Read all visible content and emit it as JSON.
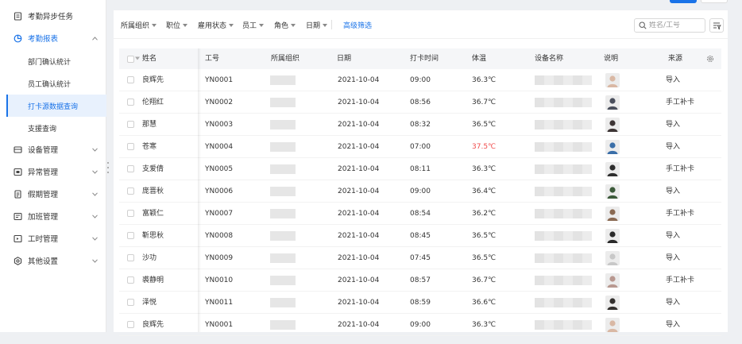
{
  "sidebar": {
    "items": [
      {
        "label": "考勤异步任务",
        "icon": "task-list-icon"
      },
      {
        "label": "考勤报表",
        "icon": "chart-pie-icon",
        "expanded": true,
        "children": [
          {
            "label": "部门确认统计"
          },
          {
            "label": "员工确认统计"
          },
          {
            "label": "打卡源数据查询",
            "selected": true
          },
          {
            "label": "支援查询"
          }
        ]
      },
      {
        "label": "设备管理",
        "icon": "device-icon"
      },
      {
        "label": "异常管理",
        "icon": "alert-box-icon"
      },
      {
        "label": "假期管理",
        "icon": "calendar-doc-icon"
      },
      {
        "label": "加班管理",
        "icon": "overtime-icon"
      },
      {
        "label": "工时管理",
        "icon": "worktime-icon"
      },
      {
        "label": "其他设置",
        "icon": "settings-icon"
      }
    ]
  },
  "filters": {
    "org": "所属组织",
    "position": "职位",
    "employment": "雇用状态",
    "employee": "员工",
    "role": "角色",
    "date": "日期",
    "advanced": "高级筛选"
  },
  "search": {
    "placeholder": "姓名/工号",
    "value": ""
  },
  "table": {
    "headers": {
      "name": "姓名",
      "id": "工号",
      "org": "所属组织",
      "date": "日期",
      "punch_time": "打卡时间",
      "temperature": "体温",
      "device": "设备名称",
      "note": "说明",
      "source": "来源"
    },
    "rows": [
      {
        "name": "良辉先",
        "id": "YN0001",
        "date": "2021-10-04",
        "time": "09:00",
        "temp": "36.3℃",
        "source": "导入",
        "avatar_color": "#d9b8a4"
      },
      {
        "name": "伦翔红",
        "id": "YN0002",
        "date": "2021-10-04",
        "time": "08:56",
        "temp": "36.7℃",
        "source": "手工补卡",
        "avatar_color": "#4a4f5c"
      },
      {
        "name": "那慧",
        "id": "YN0003",
        "date": "2021-10-04",
        "time": "08:32",
        "temp": "36.5℃",
        "source": "导入",
        "avatar_color": "#3d3535"
      },
      {
        "name": "苍寒",
        "id": "YN0004",
        "date": "2021-10-04",
        "time": "07:00",
        "temp": "37.5℃",
        "source": "导入",
        "avatar_color": "#3a6ea8",
        "temp_alert": "#f04b4b"
      },
      {
        "name": "支爱倩",
        "id": "YN0005",
        "date": "2021-10-04",
        "time": "08:11",
        "temp": "36.3℃",
        "source": "手工补卡",
        "avatar_color": "#2e2e2e"
      },
      {
        "name": "庞晋秋",
        "id": "YN0006",
        "date": "2021-10-04",
        "time": "09:00",
        "temp": "36.4℃",
        "source": "导入",
        "avatar_color": "#3c5a3a"
      },
      {
        "name": "富颖仁",
        "id": "YN0007",
        "date": "2021-10-04",
        "time": "08:54",
        "temp": "36.2℃",
        "source": "手工补卡",
        "avatar_color": "#8a6a52"
      },
      {
        "name": "靳思秋",
        "id": "YN0008",
        "date": "2021-10-04",
        "time": "08:45",
        "temp": "36.5℃",
        "source": "导入",
        "avatar_color": "#2a2a2a"
      },
      {
        "name": "沙功",
        "id": "YN0009",
        "date": "2021-10-04",
        "time": "07:45",
        "temp": "36.5℃",
        "source": "导入",
        "avatar_color": "#c8c8c8"
      },
      {
        "name": "裘静明",
        "id": "YN0010",
        "date": "2021-10-04",
        "time": "08:57",
        "temp": "36.7℃",
        "source": "手工补卡",
        "avatar_color": "#b89890"
      },
      {
        "name": "泽悦",
        "id": "YN0011",
        "date": "2021-10-04",
        "time": "08:59",
        "temp": "36.6℃",
        "source": "导入",
        "avatar_color": "#33302e"
      },
      {
        "name": "良辉先",
        "id": "YN0001",
        "date": "2021-10-04",
        "time": "09:00",
        "temp": "36.3℃",
        "source": "导入",
        "avatar_color": "#d9b8a4"
      }
    ]
  },
  "colors": {
    "accent": "#1a73e8",
    "alert": "#f04b4b"
  }
}
